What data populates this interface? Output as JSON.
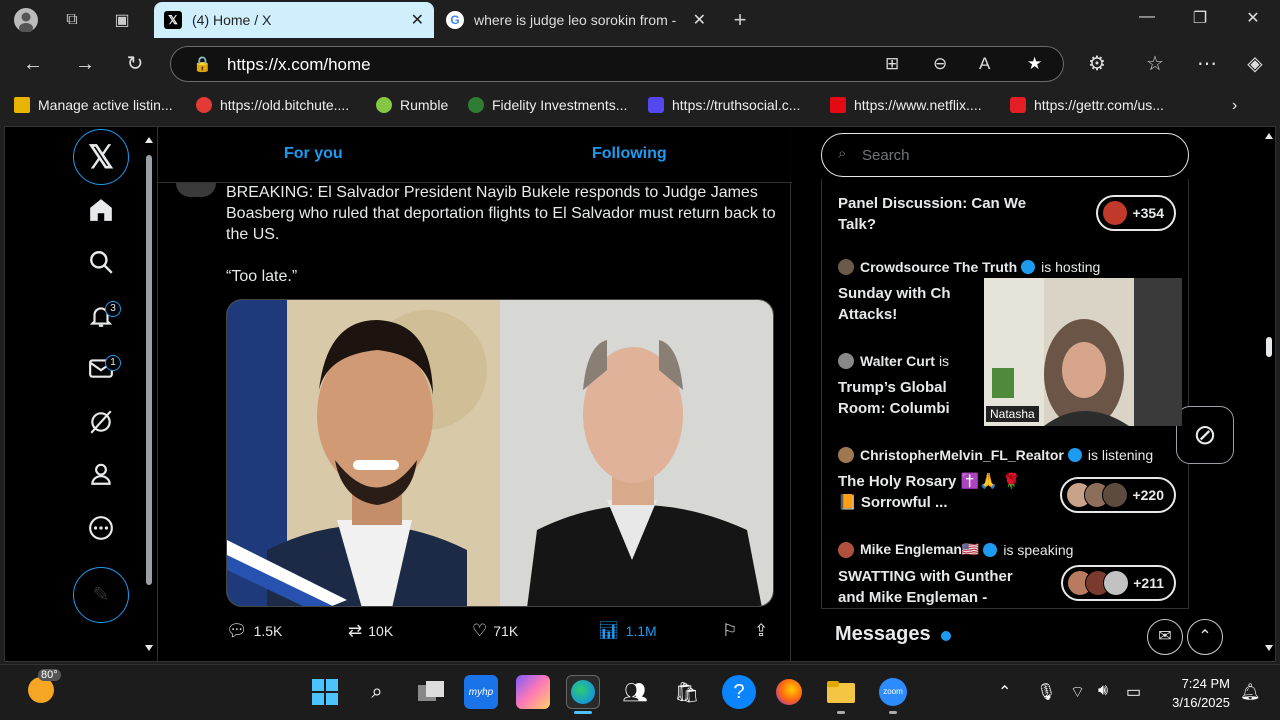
{
  "browser": {
    "tabs": [
      {
        "title": "(4) Home / X",
        "favicon": "x-logo",
        "active": true
      },
      {
        "title": "where is judge leo sorokin from -",
        "favicon": "google-g",
        "active": false
      }
    ],
    "new_tab": "+",
    "url": "https://x.com/home",
    "bookmarks": [
      {
        "label": "Manage active listin...",
        "color": "#e9b400"
      },
      {
        "label": "https://old.bitchute....",
        "color": "#e53935"
      },
      {
        "label": "Rumble",
        "color": "#85c742"
      },
      {
        "label": "Fidelity Investments...",
        "color": "#2e7d32"
      },
      {
        "label": "https://truthsocial.c...",
        "color": "#5448ee"
      },
      {
        "label": "https://www.netflix....",
        "color": "#e50914"
      },
      {
        "label": "https://gettr.com/us...",
        "color": "#e31e24"
      }
    ]
  },
  "x": {
    "sidebar": {
      "notifications_badge": "3",
      "messages_badge": "1"
    },
    "home_tabs": {
      "for_you": "For you",
      "following": "Following"
    },
    "tweet": {
      "text": "BREAKING: El Salvador President Nayib Bukele responds to Judge James Boasberg who ruled that deportation flights to El Salvador must return back to the US.",
      "quote": "“Too late.”",
      "replies": "1.5K",
      "reposts": "10K",
      "likes": "71K",
      "views": "1.1M"
    },
    "search_placeholder": "Search",
    "spaces": [
      {
        "host": "",
        "status": "",
        "title": "Panel Discussion: Can We Talk?",
        "count": "+354"
      },
      {
        "host": "Crowdsource The Truth",
        "status": "is hosting",
        "title": "Sunday with Ch Attacks!",
        "count": ""
      },
      {
        "host": "Walter Curt",
        "status": "is",
        "title": "Trump’s Global Room: Columbi",
        "count": ""
      },
      {
        "host": "ChristopherMelvin_FL_Realtor",
        "status": "is listening",
        "title": "The Holy Rosary ✝️🙏 🌹 📙 Sorrowful ...",
        "count": "+220"
      },
      {
        "host": "Mike Engleman🇺🇸",
        "status": "is speaking",
        "title": "SWATTING with Gunther and Mike Engleman -",
        "count": "+211"
      }
    ],
    "messages_title": "Messages"
  },
  "webcam_label": "Natasha",
  "taskbar": {
    "weather": "80°",
    "time": "7:24 PM",
    "date": "3/16/2025"
  },
  "colors": {
    "accent": "#1d9bf0",
    "active_tab": "#cfeffd"
  }
}
